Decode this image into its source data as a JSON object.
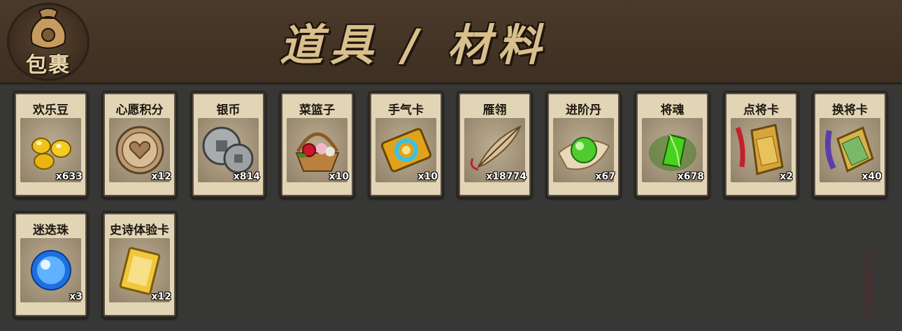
{
  "header": {
    "bag_label": "包裹",
    "title": "道具 / 材料"
  },
  "items": [
    {
      "name": "欢乐豆",
      "count": "x633",
      "icon": "gold-beans-icon"
    },
    {
      "name": "心愿积分",
      "count": "x12",
      "icon": "heart-coin-icon"
    },
    {
      "name": "银币",
      "count": "x814",
      "icon": "silver-coins-icon"
    },
    {
      "name": "菜篮子",
      "count": "x10",
      "icon": "flower-basket-icon"
    },
    {
      "name": "手气卡",
      "count": "x10",
      "icon": "luck-card-icon"
    },
    {
      "name": "雁翎",
      "count": "x18774",
      "icon": "feather-icon"
    },
    {
      "name": "进阶丹",
      "count": "x67",
      "icon": "green-pill-icon"
    },
    {
      "name": "将魂",
      "count": "x678",
      "icon": "green-crystal-icon"
    },
    {
      "name": "点将卡",
      "count": "x2",
      "icon": "general-token-icon"
    },
    {
      "name": "换将卡",
      "count": "x40",
      "icon": "swap-token-icon"
    },
    {
      "name": "迷迭珠",
      "count": "x3",
      "icon": "blue-orb-icon"
    },
    {
      "name": "史诗体验卡",
      "count": "x12",
      "icon": "gold-card-icon"
    }
  ],
  "colors": {
    "background": "#373736",
    "header": "#4a3a2a",
    "slot": "#e2d5b6",
    "title": "#d8bf8c"
  }
}
